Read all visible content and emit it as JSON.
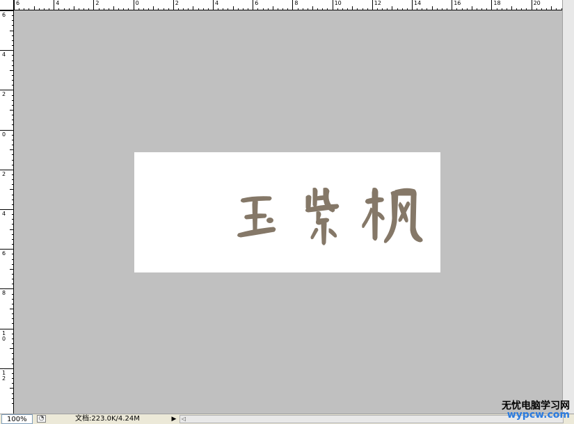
{
  "ruler_top": {
    "labels": [
      "6",
      "4",
      "2",
      "0",
      "2",
      "4",
      "6",
      "8",
      "10",
      "12",
      "14",
      "16",
      "18",
      "20"
    ],
    "start_value": -6,
    "step": 2
  },
  "ruler_left": {
    "labels": [
      "6",
      "4",
      "2",
      "0",
      "2",
      "4",
      "6",
      "8",
      "10",
      "12"
    ],
    "start_value": -6,
    "step": 2
  },
  "document": {
    "calligraphy_text": "玉紫枫",
    "ink_color": "#857868",
    "background_color": "#ffffff"
  },
  "canvas": {
    "pasteboard_color": "#c0c0c0"
  },
  "status": {
    "zoom": "100%",
    "doc_info": "文档:223.0K/4.24M",
    "arrow_icon": "triangle-right-icon"
  },
  "watermark": {
    "title": "无忧电脑学习网",
    "url": "wypcw.com"
  }
}
